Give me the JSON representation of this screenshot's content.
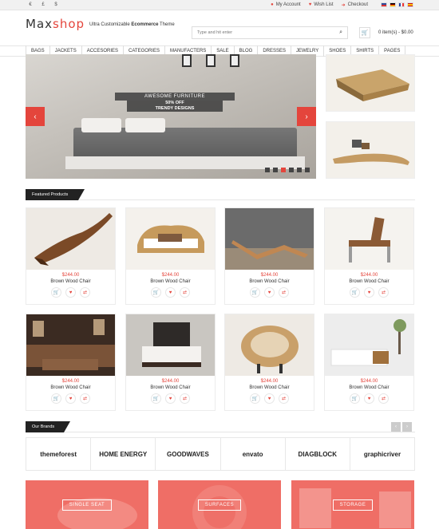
{
  "topbar": {
    "currencies": [
      "€",
      "£",
      "$"
    ],
    "links": [
      {
        "label": "My Account",
        "icon": "user-icon"
      },
      {
        "label": "Wish List",
        "icon": "heart-icon"
      },
      {
        "label": "Checkout",
        "icon": "checkout-icon"
      }
    ],
    "flags": [
      "en",
      "de",
      "fr",
      "es"
    ]
  },
  "header": {
    "logo_part1": "Max",
    "logo_part2": "shop",
    "tagline_prefix": "Ultra Customizable",
    "tagline_bold": "Ecommerce",
    "tagline_suffix": "Theme",
    "search_placeholder": "Type and hit enter",
    "cart_text": "0 item(s) - $0.00"
  },
  "nav": [
    "BAGS",
    "JACKETS",
    "ACCESORIES",
    "CATEGORIES",
    "MANUFACTERS",
    "SALE",
    "BLOG",
    "DRESSES",
    "JEWELRY",
    "SHOES",
    "SHIRTS",
    "PAGES"
  ],
  "slider": {
    "title": "AWESOME FURNITURE",
    "line1": "50% OFF",
    "line2_prefix": "TRENDY",
    "line2_bold": "DESIGNS",
    "dot_count": 6,
    "active_dot": 2
  },
  "featured": {
    "title": "Featured Products",
    "products": [
      {
        "price": "$244.00",
        "name": "Brown Wood Chair"
      },
      {
        "price": "$244.00",
        "name": "Brown Wood Chair"
      },
      {
        "price": "$244.00",
        "name": "Brown Wood Chair"
      },
      {
        "price": "$244.00",
        "name": "Brown Wood Chair"
      },
      {
        "price": "$244.00",
        "name": "Brown Wood Chair"
      },
      {
        "price": "$244.00",
        "name": "Brown Wood Chair"
      },
      {
        "price": "$244.00",
        "name": "Brown Wood Chair"
      },
      {
        "price": "$244.00",
        "name": "Brown Wood Chair"
      }
    ]
  },
  "brands": {
    "title": "Our Brands",
    "items": [
      "themeforest",
      "HOME ENERGY",
      "GOODWAVES",
      "envato",
      "DIAGBLOCK",
      "graphicriver"
    ]
  },
  "promos": [
    "SINGLE SEAT",
    "SURFACES",
    "STORAGE"
  ],
  "colors": {
    "accent": "#e4453c",
    "promo": "#ef6e66",
    "dark": "#222222"
  }
}
